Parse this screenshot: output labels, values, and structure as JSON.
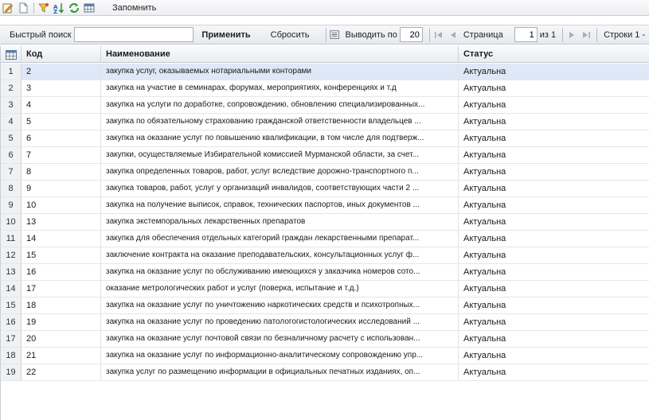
{
  "toolbar": {
    "icons": [
      "edit-icon",
      "new-document-icon",
      "filter-icon",
      "sort-icon",
      "refresh-icon",
      "table-settings-icon"
    ],
    "remember_label": "Запомнить"
  },
  "searchbar": {
    "quick_search_label": "Быстрый поиск",
    "search_value": "",
    "apply_label": "Применить",
    "reset_label": "Сбросить",
    "page_size_label": "Выводить по",
    "page_size_value": "20",
    "page_label": "Страница",
    "page_value": "1",
    "page_total": "из 1",
    "rows_label": "Строки 1 -"
  },
  "grid": {
    "columns": {
      "code": "Код",
      "name": "Наименование",
      "status": "Статус"
    },
    "rows": [
      {
        "n": "1",
        "code": "2",
        "name": "закупка услуг, оказываемых нотариальными конторами",
        "status": "Актуальна"
      },
      {
        "n": "2",
        "code": "3",
        "name": "закупка на участие в семинарах, форумах, мероприятиях, конференциях и т.д",
        "status": "Актуальна"
      },
      {
        "n": "3",
        "code": "4",
        "name": "закупка на услуги по доработке, сопровождению, обновлению специализированных...",
        "status": "Актуальна"
      },
      {
        "n": "4",
        "code": "5",
        "name": "закупка по обязательному страхованию гражданской ответственности владельцев ...",
        "status": "Актуальна"
      },
      {
        "n": "5",
        "code": "6",
        "name": "закупка на оказание услуг по повышению квалификации, в том числе для подтверж...",
        "status": "Актуальна"
      },
      {
        "n": "6",
        "code": "7",
        "name": "закупки, осуществляемые Избирательной комиссией Мурманской области, за счет...",
        "status": "Актуальна"
      },
      {
        "n": "7",
        "code": "8",
        "name": "закупка определенных товаров, работ, услуг вследствие дорожно-транспортного п...",
        "status": "Актуальна"
      },
      {
        "n": "8",
        "code": "9",
        "name": "закупка товаров, работ, услуг у организаций инвалидов, соответствующих части 2 ...",
        "status": "Актуальна"
      },
      {
        "n": "9",
        "code": "10",
        "name": "закупка на получение выписок, справок, технических паспортов, иных документов ...",
        "status": "Актуальна"
      },
      {
        "n": "10",
        "code": "13",
        "name": "закупка экстемпоральных лекарственных препаратов",
        "status": "Актуальна"
      },
      {
        "n": "11",
        "code": "14",
        "name": "закупка для обеспечения отдельных категорий граждан лекарственными препарат...",
        "status": "Актуальна"
      },
      {
        "n": "12",
        "code": "15",
        "name": "заключение контракта на оказание преподавательских, консультационных услуг ф...",
        "status": "Актуальна"
      },
      {
        "n": "13",
        "code": "16",
        "name": "закупка на оказание услуг по обслуживанию имеющихся у заказчика номеров сото...",
        "status": "Актуальна"
      },
      {
        "n": "14",
        "code": "17",
        "name": "оказание метрологических работ и услуг (поверка, испытание и т.д.)",
        "status": "Актуальна"
      },
      {
        "n": "15",
        "code": "18",
        "name": "закупка на оказание услуг по уничтожению наркотических средств и психотропных...",
        "status": "Актуальна"
      },
      {
        "n": "16",
        "code": "19",
        "name": "закупка на оказание услуг по проведению патологогистологических исследований ...",
        "status": "Актуальна"
      },
      {
        "n": "17",
        "code": "20",
        "name": "закупка на оказание услуг почтовой связи по безналичному расчету с использован...",
        "status": "Актуальна"
      },
      {
        "n": "18",
        "code": "21",
        "name": "закупка на оказание услуг по информационно-аналитическому сопровождению упр...",
        "status": "Актуальна"
      },
      {
        "n": "19",
        "code": "22",
        "name": "закупка услуг по размещению информации в официальных печатных изданиях, оп...",
        "status": "Актуальна"
      }
    ]
  }
}
